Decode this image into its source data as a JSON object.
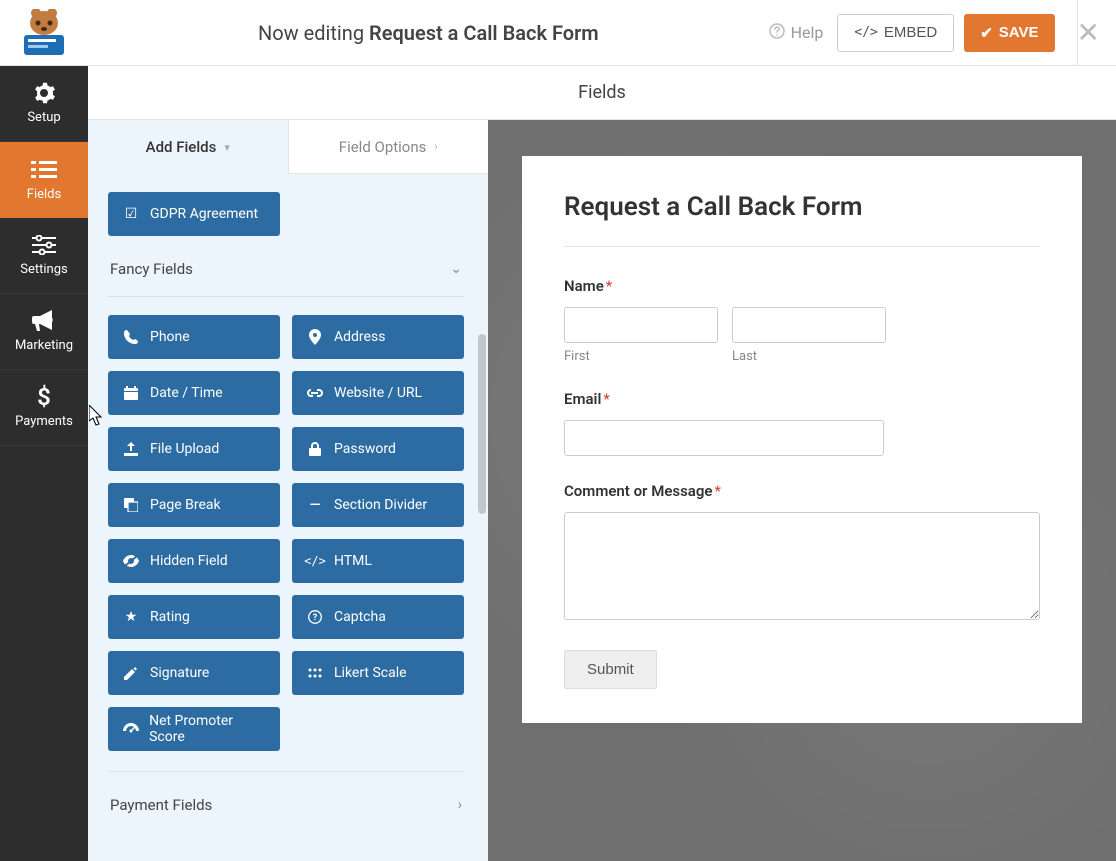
{
  "header": {
    "title_prefix": "Now editing",
    "title_form": "Request a Call Back Form",
    "help": "Help",
    "embed": "EMBED",
    "save": "SAVE"
  },
  "nav": {
    "setup": "Setup",
    "fields": "Fields",
    "settings": "Settings",
    "marketing": "Marketing",
    "payments": "Payments"
  },
  "subheader": "Fields",
  "tabs": {
    "add_fields": "Add Fields",
    "field_options": "Field Options"
  },
  "sections": {
    "fancy": "Fancy Fields",
    "payment": "Payment Fields"
  },
  "field_buttons": {
    "gdpr": "GDPR Agreement",
    "phone": "Phone",
    "address": "Address",
    "datetime": "Date / Time",
    "website": "Website / URL",
    "fileupload": "File Upload",
    "password": "Password",
    "pagebreak": "Page Break",
    "sectiondivider": "Section Divider",
    "hiddenfield": "Hidden Field",
    "html": "HTML",
    "rating": "Rating",
    "captcha": "Captcha",
    "signature": "Signature",
    "likert": "Likert Scale",
    "nps": "Net Promoter Score"
  },
  "preview": {
    "form_title": "Request a Call Back Form",
    "name_label": "Name",
    "first": "First",
    "last": "Last",
    "email_label": "Email",
    "comment_label": "Comment or Message",
    "submit": "Submit"
  }
}
